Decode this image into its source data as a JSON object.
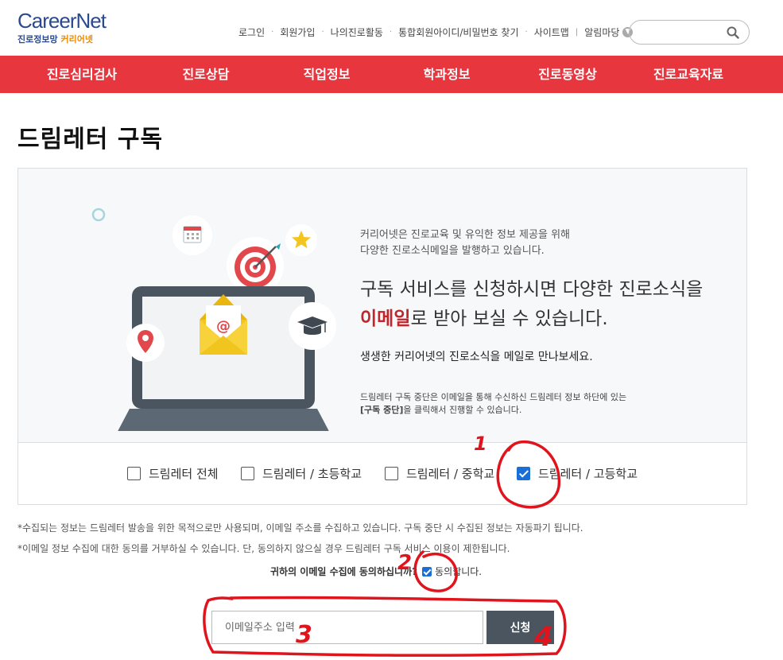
{
  "logo": {
    "brand": "CareerNet",
    "sub_left": "진로정보망",
    "sub_right": "커리어넷"
  },
  "top_links": [
    "로그인",
    "회원가입",
    "나의진로활동",
    "통합회원아이디/비밀번호 찾기",
    "사이트맵",
    "알림마당"
  ],
  "search": {
    "placeholder": ""
  },
  "nav": [
    "진로심리검사",
    "진로상담",
    "직업정보",
    "학과정보",
    "진로동영상",
    "진로교육자료"
  ],
  "page_title": "드림레터 구독",
  "intro": [
    "커리어넷은 진로교육 및 유익한 정보 제공을 위해",
    "다양한 진로소식메일을 발행하고 있습니다."
  ],
  "headline": {
    "line1": "구독 서비스를 신청하시면 다양한 진로소식을",
    "emphasis": "이메일",
    "line2_rest": "로 받아 보실 수 있습니다."
  },
  "meet": "생생한 커리어넷의 진로소식을 메일로 만나보세요.",
  "note": {
    "line1": "드림레터 구독 중단은 이메일을 통해 수신하신 드림레터 정보 하단에 있는",
    "bold": "[구독 중단]",
    "line2_rest": "을 클릭해서 진행할 수 있습니다."
  },
  "options": [
    {
      "label": "드림레터 전체",
      "checked": false
    },
    {
      "label": "드림레터 / 초등학교",
      "checked": false
    },
    {
      "label": "드림레터 / 중학교",
      "checked": false
    },
    {
      "label": "드림레터 / 고등학교",
      "checked": true
    }
  ],
  "notices": [
    "*수집되는 정보는 드림레터 발송을 위한 목적으로만 사용되며, 이메일 주소를 수집하고 있습니다. 구독 중단 시 수집된 정보는 자동파기 됩니다.",
    "*이메일 정보 수집에 대한 동의를 거부하실 수 있습니다. 단, 동의하지 않으실 경우 드림레터 구독 서비스 이용이 제한됩니다."
  ],
  "consent": {
    "question": "귀하의 이메일 수집에 동의하십니까?",
    "agree": "동의합니다.",
    "checked": true
  },
  "email": {
    "placeholder": "이메일주소 입력"
  },
  "submit_label": "신청",
  "annotations": [
    "1",
    "2",
    "3",
    "4"
  ],
  "colors": {
    "nav_red": "#e8363f",
    "accent_red": "#c0272d",
    "check_blue": "#1a6fd6",
    "button_gray": "#4a5560",
    "annotation_red": "#e0141c"
  }
}
